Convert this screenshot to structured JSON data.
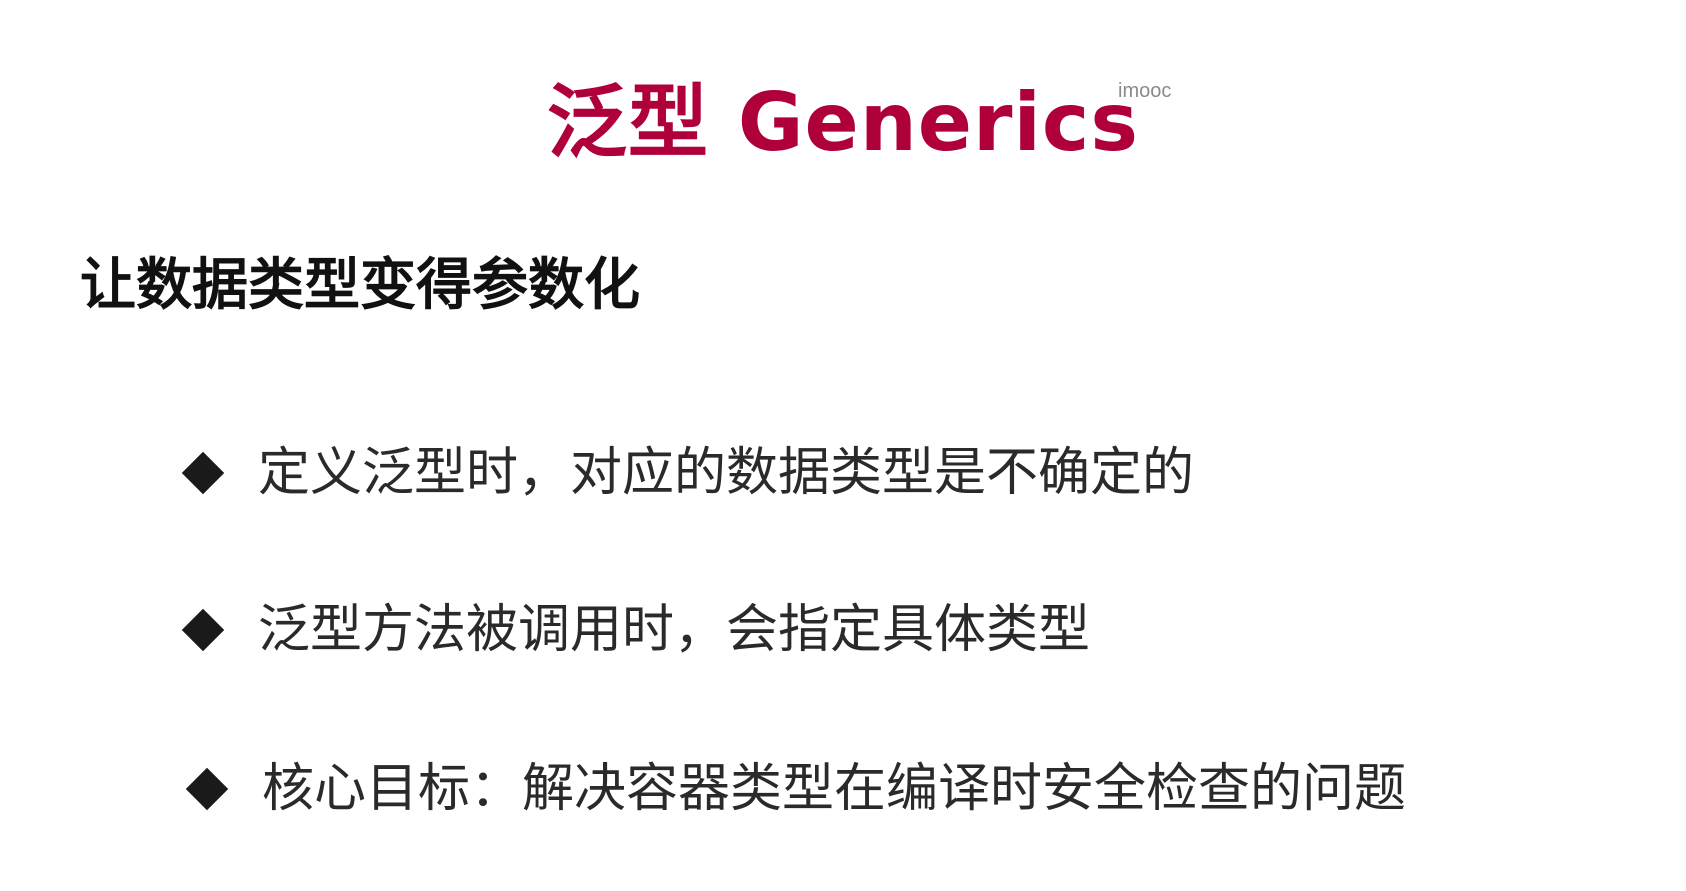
{
  "slide": {
    "title": "泛型 Generics",
    "watermark": "imooc",
    "subtitle": "让数据类型变得参数化",
    "bullets": [
      "定义泛型时，对应的数据类型是不确定的",
      "泛型方法被调用时，会指定具体类型",
      "核心目标：解决容器类型在编译时安全检查的问题"
    ]
  },
  "colors": {
    "title": "#b0003a",
    "text": "#2a2a2a",
    "subtitle": "#111111",
    "bullet_marker": "#1a1a1a"
  },
  "icons": {
    "bullet_marker": "diamond-bullet-icon"
  }
}
